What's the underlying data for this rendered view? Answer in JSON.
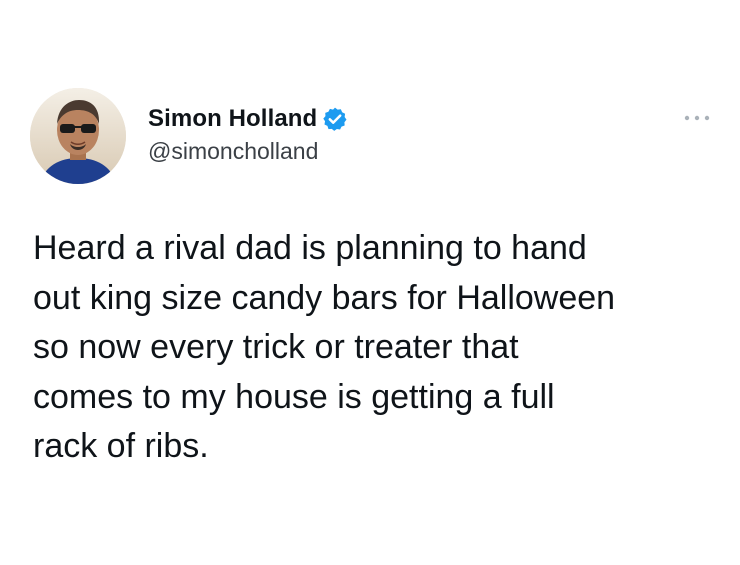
{
  "author": {
    "display_name": "Simon Holland",
    "handle": "@simoncholland",
    "verified": true,
    "verified_color": "#1d9bf0"
  },
  "icons": {
    "verified": "verified-badge-icon",
    "more": "more-options-icon"
  },
  "tweet": {
    "lines": [
      "Heard a rival dad is planning to hand",
      "out king size candy bars for Halloween",
      "so now every trick or treater that",
      "comes to my house is getting a full",
      "rack of ribs."
    ]
  }
}
